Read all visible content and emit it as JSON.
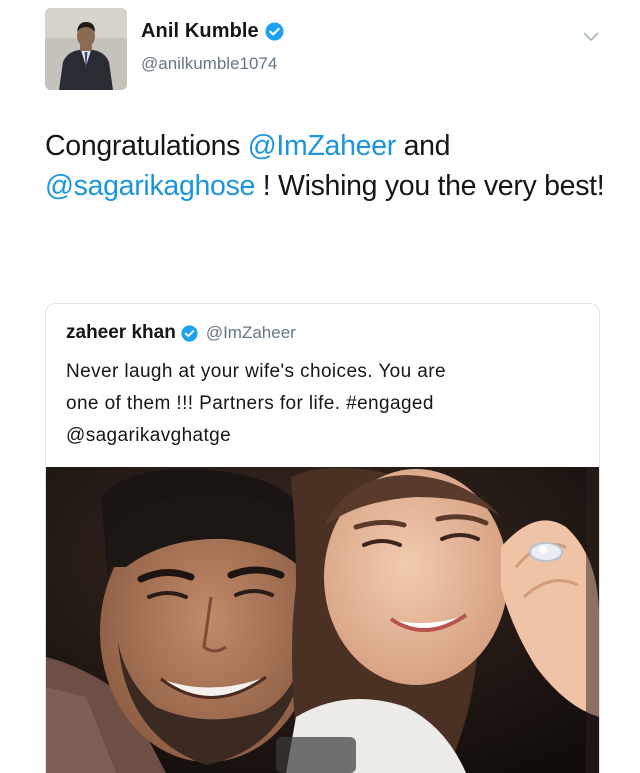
{
  "tweet": {
    "author_name": "Anil Kumble",
    "author_handle": "@anilkumble1074",
    "text": {
      "part1": "Congratulations ",
      "mention1": "@ImZaheer",
      "part2": " and",
      "mention2": "@sagarikaghose",
      "part3": " ! Wishing you the very best!"
    },
    "icons": {
      "verified": "verified-badge-icon",
      "menu": "chevron-down-icon"
    }
  },
  "quoted_tweet": {
    "author_name": "zaheer khan",
    "author_handle": "@ImZaheer",
    "text_line1": "Never laugh at your wife's choices. You are",
    "text_line2": "one of them !!!  Partners for life. #engaged",
    "text_line3": "@sagarikavghatge",
    "media": "engagement-selfie-photo"
  },
  "colors": {
    "link": "#1b95e0",
    "verified": "#1da1f2",
    "secondary_text": "#657786"
  }
}
